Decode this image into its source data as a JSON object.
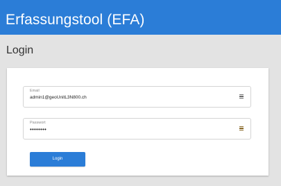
{
  "header": {
    "title": "Erfassungstool (EFA)",
    "background": "#2b7dd7"
  },
  "page": {
    "title": "Login"
  },
  "form": {
    "email": {
      "label": "Email",
      "value": "admin1@geoUnitL3N800.ch",
      "icon": "key-list-icon"
    },
    "password": {
      "label": "Passwort",
      "value": "••••••••",
      "icon": "key-list-icon"
    },
    "submit_label": "Login",
    "accent": "#2b7dd7"
  }
}
